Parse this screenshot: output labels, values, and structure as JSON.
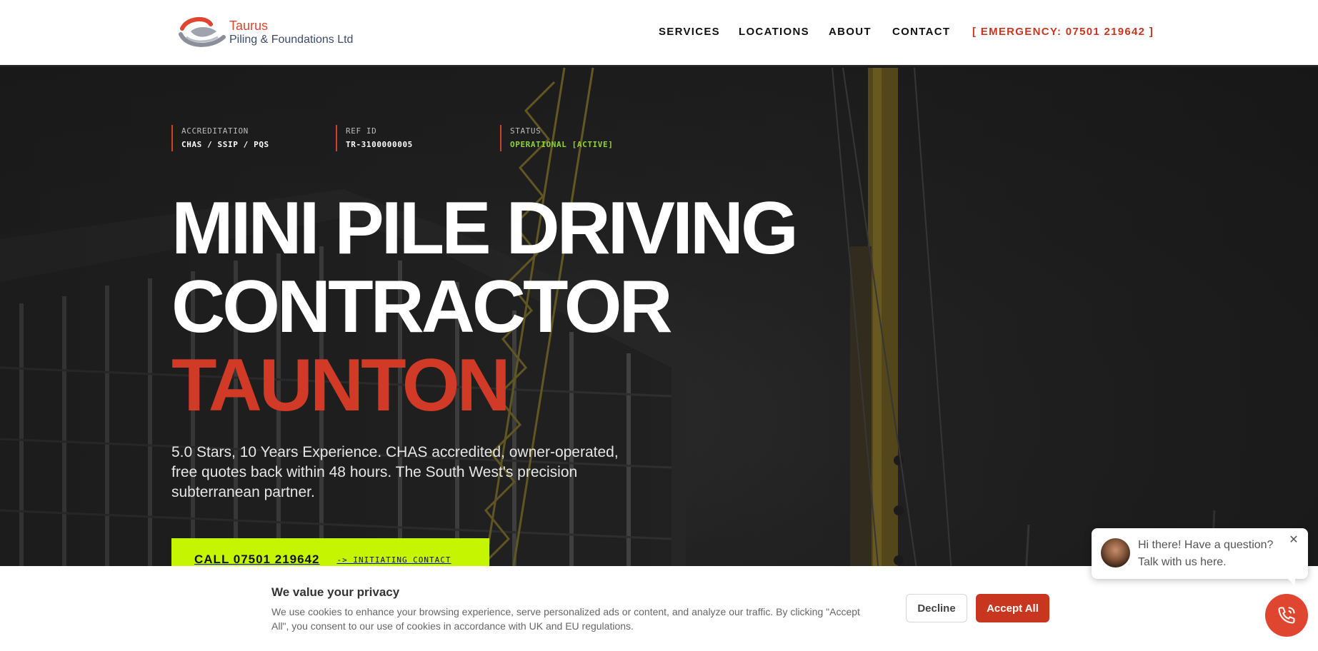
{
  "brand": {
    "name": "Taurus",
    "subtitle": "Piling & Foundations Ltd",
    "accent": "#e0452f",
    "secondary": "#3d4a6b"
  },
  "nav": {
    "items": [
      "SERVICES",
      "LOCATIONS",
      "ABOUT",
      "CONTACT"
    ],
    "emergency": "[ EMERGENCY: 07501 219642 ]"
  },
  "hero": {
    "meta": [
      {
        "label": "ACCREDITATION",
        "value": "CHAS / SSIP / PQS"
      },
      {
        "label": "REF ID",
        "value": "TR-3100000005"
      },
      {
        "label": "STATUS",
        "value": "OPERATIONAL [ACTIVE]"
      }
    ],
    "headline": [
      "MINI PILE DRIVING",
      "CONTRACTOR"
    ],
    "city": "TAUNTON",
    "subtext": "5.0 Stars, 10 Years Experience. CHAS accredited, owner-operated, free quotes back within 48 hours. The South West's precision subterranean partner.",
    "cta": {
      "label": "CALL 07501 219642",
      "sub": "-> INITIATING CONTACT",
      "color": "#c6f500"
    }
  },
  "cookie": {
    "title": "We value your privacy",
    "text": "We use cookies to enhance your browsing experience, serve personalized ads or content, and analyze our traffic. By clicking \"Accept All\", you consent to our use of cookies in accordance with UK and EU regulations.",
    "decline": "Decline",
    "accept": "Accept All",
    "accept_color": "#c8361f"
  },
  "chat": {
    "message": "Hi there! Have a question? Talk with us here.",
    "close_icon": "close-icon",
    "fab_icon": "phone-icon"
  }
}
